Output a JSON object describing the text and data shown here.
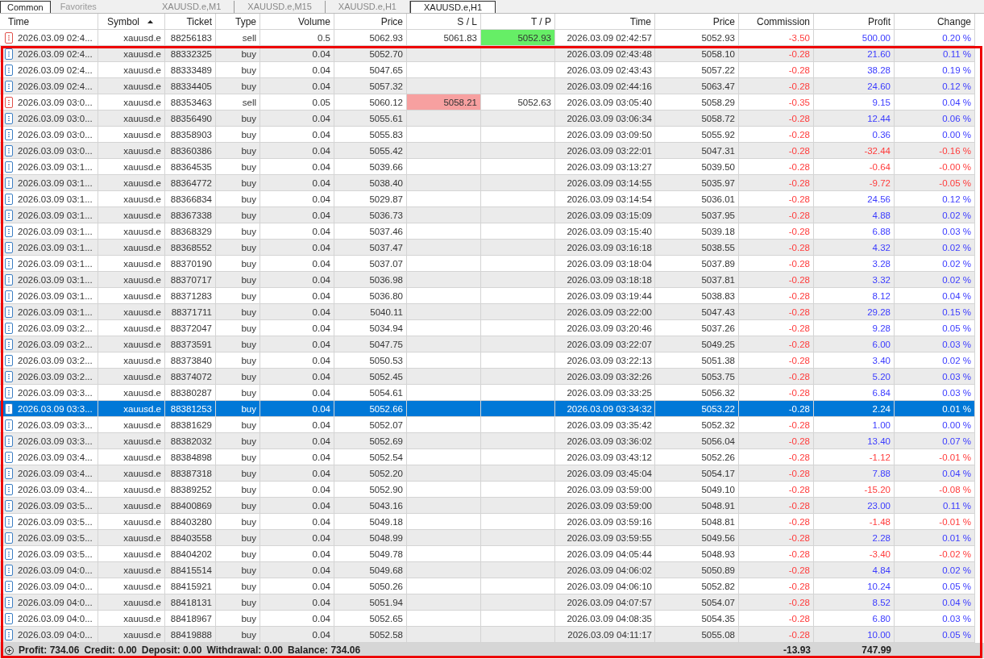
{
  "top_tabs": [
    {
      "label": "Common",
      "selected": true
    },
    {
      "label": "Favorites",
      "selected": false
    }
  ],
  "chart_tabs": [
    {
      "label": "XAUUSD.e,M1",
      "selected": false
    },
    {
      "label": "XAUUSD.e,M15",
      "selected": false
    },
    {
      "label": "XAUUSD.e,H1",
      "selected": false
    },
    {
      "label": "XAUUSD.e,H1",
      "selected": true
    }
  ],
  "table": {
    "columns": [
      {
        "label": "Time",
        "sorted": false
      },
      {
        "label": "Symbol",
        "sorted": true
      },
      {
        "label": "Ticket",
        "sorted": false
      },
      {
        "label": "Type",
        "sorted": false
      },
      {
        "label": "Volume",
        "sorted": false
      },
      {
        "label": "Price",
        "sorted": false
      },
      {
        "label": "S / L",
        "sorted": false
      },
      {
        "label": "T / P",
        "sorted": false
      },
      {
        "label": "Time",
        "sorted": false
      },
      {
        "label": "Price",
        "sorted": false
      },
      {
        "label": "Commission",
        "sorted": false
      },
      {
        "label": "Profit",
        "sorted": false
      },
      {
        "label": "Change",
        "sorted": false
      }
    ],
    "rows": [
      {
        "kind": "sell",
        "cells": [
          "2026.03.09 02:4...",
          "xauusd.e",
          "88256183",
          "sell",
          "0.5",
          "5062.93",
          "5061.83",
          "5052.93",
          "2026.03.09 02:42:57",
          "5052.93",
          "-3.50",
          "500.00",
          "0.20 %"
        ],
        "sl_hit": false,
        "tp_hit": true,
        "loss": false,
        "selected": false
      },
      {
        "kind": "buy",
        "cells": [
          "2026.03.09 02:4...",
          "xauusd.e",
          "88332325",
          "buy",
          "0.04",
          "5052.70",
          "",
          "",
          "2026.03.09 02:43:48",
          "5058.10",
          "-0.28",
          "21.60",
          "0.11 %"
        ],
        "sl_hit": false,
        "tp_hit": false,
        "loss": false,
        "selected": false
      },
      {
        "kind": "buy",
        "cells": [
          "2026.03.09 02:4...",
          "xauusd.e",
          "88333489",
          "buy",
          "0.04",
          "5047.65",
          "",
          "",
          "2026.03.09 02:43:43",
          "5057.22",
          "-0.28",
          "38.28",
          "0.19 %"
        ],
        "sl_hit": false,
        "tp_hit": false,
        "loss": false,
        "selected": false
      },
      {
        "kind": "buy",
        "cells": [
          "2026.03.09 02:4...",
          "xauusd.e",
          "88334405",
          "buy",
          "0.04",
          "5057.32",
          "",
          "",
          "2026.03.09 02:44:16",
          "5063.47",
          "-0.28",
          "24.60",
          "0.12 %"
        ],
        "sl_hit": false,
        "tp_hit": false,
        "loss": false,
        "selected": false
      },
      {
        "kind": "sell",
        "cells": [
          "2026.03.09 03:0...",
          "xauusd.e",
          "88353463",
          "sell",
          "0.05",
          "5060.12",
          "5058.21",
          "5052.63",
          "2026.03.09 03:05:40",
          "5058.29",
          "-0.35",
          "9.15",
          "0.04 %"
        ],
        "sl_hit": true,
        "tp_hit": false,
        "loss": false,
        "selected": false
      },
      {
        "kind": "buy",
        "cells": [
          "2026.03.09 03:0...",
          "xauusd.e",
          "88356490",
          "buy",
          "0.04",
          "5055.61",
          "",
          "",
          "2026.03.09 03:06:34",
          "5058.72",
          "-0.28",
          "12.44",
          "0.06 %"
        ],
        "sl_hit": false,
        "tp_hit": false,
        "loss": false,
        "selected": false
      },
      {
        "kind": "buy",
        "cells": [
          "2026.03.09 03:0...",
          "xauusd.e",
          "88358903",
          "buy",
          "0.04",
          "5055.83",
          "",
          "",
          "2026.03.09 03:09:50",
          "5055.92",
          "-0.28",
          "0.36",
          "0.00 %"
        ],
        "sl_hit": false,
        "tp_hit": false,
        "loss": false,
        "selected": false
      },
      {
        "kind": "buy",
        "cells": [
          "2026.03.09 03:0...",
          "xauusd.e",
          "88360386",
          "buy",
          "0.04",
          "5055.42",
          "",
          "",
          "2026.03.09 03:22:01",
          "5047.31",
          "-0.28",
          "-32.44",
          "-0.16 %"
        ],
        "sl_hit": false,
        "tp_hit": false,
        "loss": true,
        "selected": false
      },
      {
        "kind": "buy",
        "cells": [
          "2026.03.09 03:1...",
          "xauusd.e",
          "88364535",
          "buy",
          "0.04",
          "5039.66",
          "",
          "",
          "2026.03.09 03:13:27",
          "5039.50",
          "-0.28",
          "-0.64",
          "-0.00 %"
        ],
        "sl_hit": false,
        "tp_hit": false,
        "loss": true,
        "selected": false
      },
      {
        "kind": "buy",
        "cells": [
          "2026.03.09 03:1...",
          "xauusd.e",
          "88364772",
          "buy",
          "0.04",
          "5038.40",
          "",
          "",
          "2026.03.09 03:14:55",
          "5035.97",
          "-0.28",
          "-9.72",
          "-0.05 %"
        ],
        "sl_hit": false,
        "tp_hit": false,
        "loss": true,
        "selected": false
      },
      {
        "kind": "buy",
        "cells": [
          "2026.03.09 03:1...",
          "xauusd.e",
          "88366834",
          "buy",
          "0.04",
          "5029.87",
          "",
          "",
          "2026.03.09 03:14:54",
          "5036.01",
          "-0.28",
          "24.56",
          "0.12 %"
        ],
        "sl_hit": false,
        "tp_hit": false,
        "loss": false,
        "selected": false
      },
      {
        "kind": "buy",
        "cells": [
          "2026.03.09 03:1...",
          "xauusd.e",
          "88367338",
          "buy",
          "0.04",
          "5036.73",
          "",
          "",
          "2026.03.09 03:15:09",
          "5037.95",
          "-0.28",
          "4.88",
          "0.02 %"
        ],
        "sl_hit": false,
        "tp_hit": false,
        "loss": false,
        "selected": false
      },
      {
        "kind": "buy",
        "cells": [
          "2026.03.09 03:1...",
          "xauusd.e",
          "88368329",
          "buy",
          "0.04",
          "5037.46",
          "",
          "",
          "2026.03.09 03:15:40",
          "5039.18",
          "-0.28",
          "6.88",
          "0.03 %"
        ],
        "sl_hit": false,
        "tp_hit": false,
        "loss": false,
        "selected": false
      },
      {
        "kind": "buy",
        "cells": [
          "2026.03.09 03:1...",
          "xauusd.e",
          "88368552",
          "buy",
          "0.04",
          "5037.47",
          "",
          "",
          "2026.03.09 03:16:18",
          "5038.55",
          "-0.28",
          "4.32",
          "0.02 %"
        ],
        "sl_hit": false,
        "tp_hit": false,
        "loss": false,
        "selected": false
      },
      {
        "kind": "buy",
        "cells": [
          "2026.03.09 03:1...",
          "xauusd.e",
          "88370190",
          "buy",
          "0.04",
          "5037.07",
          "",
          "",
          "2026.03.09 03:18:04",
          "5037.89",
          "-0.28",
          "3.28",
          "0.02 %"
        ],
        "sl_hit": false,
        "tp_hit": false,
        "loss": false,
        "selected": false
      },
      {
        "kind": "buy",
        "cells": [
          "2026.03.09 03:1...",
          "xauusd.e",
          "88370717",
          "buy",
          "0.04",
          "5036.98",
          "",
          "",
          "2026.03.09 03:18:18",
          "5037.81",
          "-0.28",
          "3.32",
          "0.02 %"
        ],
        "sl_hit": false,
        "tp_hit": false,
        "loss": false,
        "selected": false
      },
      {
        "kind": "buy",
        "cells": [
          "2026.03.09 03:1...",
          "xauusd.e",
          "88371283",
          "buy",
          "0.04",
          "5036.80",
          "",
          "",
          "2026.03.09 03:19:44",
          "5038.83",
          "-0.28",
          "8.12",
          "0.04 %"
        ],
        "sl_hit": false,
        "tp_hit": false,
        "loss": false,
        "selected": false
      },
      {
        "kind": "buy",
        "cells": [
          "2026.03.09 03:1...",
          "xauusd.e",
          "88371711",
          "buy",
          "0.04",
          "5040.11",
          "",
          "",
          "2026.03.09 03:22:00",
          "5047.43",
          "-0.28",
          "29.28",
          "0.15 %"
        ],
        "sl_hit": false,
        "tp_hit": false,
        "loss": false,
        "selected": false
      },
      {
        "kind": "buy",
        "cells": [
          "2026.03.09 03:2...",
          "xauusd.e",
          "88372047",
          "buy",
          "0.04",
          "5034.94",
          "",
          "",
          "2026.03.09 03:20:46",
          "5037.26",
          "-0.28",
          "9.28",
          "0.05 %"
        ],
        "sl_hit": false,
        "tp_hit": false,
        "loss": false,
        "selected": false
      },
      {
        "kind": "buy",
        "cells": [
          "2026.03.09 03:2...",
          "xauusd.e",
          "88373591",
          "buy",
          "0.04",
          "5047.75",
          "",
          "",
          "2026.03.09 03:22:07",
          "5049.25",
          "-0.28",
          "6.00",
          "0.03 %"
        ],
        "sl_hit": false,
        "tp_hit": false,
        "loss": false,
        "selected": false
      },
      {
        "kind": "buy",
        "cells": [
          "2026.03.09 03:2...",
          "xauusd.e",
          "88373840",
          "buy",
          "0.04",
          "5050.53",
          "",
          "",
          "2026.03.09 03:22:13",
          "5051.38",
          "-0.28",
          "3.40",
          "0.02 %"
        ],
        "sl_hit": false,
        "tp_hit": false,
        "loss": false,
        "selected": false
      },
      {
        "kind": "buy",
        "cells": [
          "2026.03.09 03:2...",
          "xauusd.e",
          "88374072",
          "buy",
          "0.04",
          "5052.45",
          "",
          "",
          "2026.03.09 03:32:26",
          "5053.75",
          "-0.28",
          "5.20",
          "0.03 %"
        ],
        "sl_hit": false,
        "tp_hit": false,
        "loss": false,
        "selected": false
      },
      {
        "kind": "buy",
        "cells": [
          "2026.03.09 03:3...",
          "xauusd.e",
          "88380287",
          "buy",
          "0.04",
          "5054.61",
          "",
          "",
          "2026.03.09 03:33:25",
          "5056.32",
          "-0.28",
          "6.84",
          "0.03 %"
        ],
        "sl_hit": false,
        "tp_hit": false,
        "loss": false,
        "selected": false
      },
      {
        "kind": "buy",
        "cells": [
          "2026.03.09 03:3...",
          "xauusd.e",
          "88381253",
          "buy",
          "0.04",
          "5052.66",
          "",
          "",
          "2026.03.09 03:34:32",
          "5053.22",
          "-0.28",
          "2.24",
          "0.01 %"
        ],
        "sl_hit": false,
        "tp_hit": false,
        "loss": false,
        "selected": true
      },
      {
        "kind": "buy",
        "cells": [
          "2026.03.09 03:3...",
          "xauusd.e",
          "88381629",
          "buy",
          "0.04",
          "5052.07",
          "",
          "",
          "2026.03.09 03:35:42",
          "5052.32",
          "-0.28",
          "1.00",
          "0.00 %"
        ],
        "sl_hit": false,
        "tp_hit": false,
        "loss": false,
        "selected": false
      },
      {
        "kind": "buy",
        "cells": [
          "2026.03.09 03:3...",
          "xauusd.e",
          "88382032",
          "buy",
          "0.04",
          "5052.69",
          "",
          "",
          "2026.03.09 03:36:02",
          "5056.04",
          "-0.28",
          "13.40",
          "0.07 %"
        ],
        "sl_hit": false,
        "tp_hit": false,
        "loss": false,
        "selected": false
      },
      {
        "kind": "buy",
        "cells": [
          "2026.03.09 03:4...",
          "xauusd.e",
          "88384898",
          "buy",
          "0.04",
          "5052.54",
          "",
          "",
          "2026.03.09 03:43:12",
          "5052.26",
          "-0.28",
          "-1.12",
          "-0.01 %"
        ],
        "sl_hit": false,
        "tp_hit": false,
        "loss": true,
        "selected": false
      },
      {
        "kind": "buy",
        "cells": [
          "2026.03.09 03:4...",
          "xauusd.e",
          "88387318",
          "buy",
          "0.04",
          "5052.20",
          "",
          "",
          "2026.03.09 03:45:04",
          "5054.17",
          "-0.28",
          "7.88",
          "0.04 %"
        ],
        "sl_hit": false,
        "tp_hit": false,
        "loss": false,
        "selected": false
      },
      {
        "kind": "buy",
        "cells": [
          "2026.03.09 03:4...",
          "xauusd.e",
          "88389252",
          "buy",
          "0.04",
          "5052.90",
          "",
          "",
          "2026.03.09 03:59:00",
          "5049.10",
          "-0.28",
          "-15.20",
          "-0.08 %"
        ],
        "sl_hit": false,
        "tp_hit": false,
        "loss": true,
        "selected": false
      },
      {
        "kind": "buy",
        "cells": [
          "2026.03.09 03:5...",
          "xauusd.e",
          "88400869",
          "buy",
          "0.04",
          "5043.16",
          "",
          "",
          "2026.03.09 03:59:00",
          "5048.91",
          "-0.28",
          "23.00",
          "0.11 %"
        ],
        "sl_hit": false,
        "tp_hit": false,
        "loss": false,
        "selected": false
      },
      {
        "kind": "buy",
        "cells": [
          "2026.03.09 03:5...",
          "xauusd.e",
          "88403280",
          "buy",
          "0.04",
          "5049.18",
          "",
          "",
          "2026.03.09 03:59:16",
          "5048.81",
          "-0.28",
          "-1.48",
          "-0.01 %"
        ],
        "sl_hit": false,
        "tp_hit": false,
        "loss": true,
        "selected": false
      },
      {
        "kind": "buy",
        "cells": [
          "2026.03.09 03:5...",
          "xauusd.e",
          "88403558",
          "buy",
          "0.04",
          "5048.99",
          "",
          "",
          "2026.03.09 03:59:55",
          "5049.56",
          "-0.28",
          "2.28",
          "0.01 %"
        ],
        "sl_hit": false,
        "tp_hit": false,
        "loss": false,
        "selected": false
      },
      {
        "kind": "buy",
        "cells": [
          "2026.03.09 03:5...",
          "xauusd.e",
          "88404202",
          "buy",
          "0.04",
          "5049.78",
          "",
          "",
          "2026.03.09 04:05:44",
          "5048.93",
          "-0.28",
          "-3.40",
          "-0.02 %"
        ],
        "sl_hit": false,
        "tp_hit": false,
        "loss": true,
        "selected": false
      },
      {
        "kind": "buy",
        "cells": [
          "2026.03.09 04:0...",
          "xauusd.e",
          "88415514",
          "buy",
          "0.04",
          "5049.68",
          "",
          "",
          "2026.03.09 04:06:02",
          "5050.89",
          "-0.28",
          "4.84",
          "0.02 %"
        ],
        "sl_hit": false,
        "tp_hit": false,
        "loss": false,
        "selected": false
      },
      {
        "kind": "buy",
        "cells": [
          "2026.03.09 04:0...",
          "xauusd.e",
          "88415921",
          "buy",
          "0.04",
          "5050.26",
          "",
          "",
          "2026.03.09 04:06:10",
          "5052.82",
          "-0.28",
          "10.24",
          "0.05 %"
        ],
        "sl_hit": false,
        "tp_hit": false,
        "loss": false,
        "selected": false
      },
      {
        "kind": "buy",
        "cells": [
          "2026.03.09 04:0...",
          "xauusd.e",
          "88418131",
          "buy",
          "0.04",
          "5051.94",
          "",
          "",
          "2026.03.09 04:07:57",
          "5054.07",
          "-0.28",
          "8.52",
          "0.04 %"
        ],
        "sl_hit": false,
        "tp_hit": false,
        "loss": false,
        "selected": false
      },
      {
        "kind": "buy",
        "cells": [
          "2026.03.09 04:0...",
          "xauusd.e",
          "88418967",
          "buy",
          "0.04",
          "5052.65",
          "",
          "",
          "2026.03.09 04:08:35",
          "5054.35",
          "-0.28",
          "6.80",
          "0.03 %"
        ],
        "sl_hit": false,
        "tp_hit": false,
        "loss": false,
        "selected": false
      },
      {
        "kind": "buy",
        "cells": [
          "2026.03.09 04:0...",
          "xauusd.e",
          "88419888",
          "buy",
          "0.04",
          "5052.58",
          "",
          "",
          "2026.03.09 04:11:17",
          "5055.08",
          "-0.28",
          "10.00",
          "0.05 %"
        ],
        "sl_hit": false,
        "tp_hit": false,
        "loss": false,
        "selected": false
      }
    ]
  },
  "summary": {
    "items": [
      "Profit: 734.06",
      "Credit: 0.00",
      "Deposit: 0.00",
      "Withdrawal: 0.00",
      "Balance: 734.06"
    ],
    "commission_total": "-13.93",
    "profit_total": "747.99"
  }
}
